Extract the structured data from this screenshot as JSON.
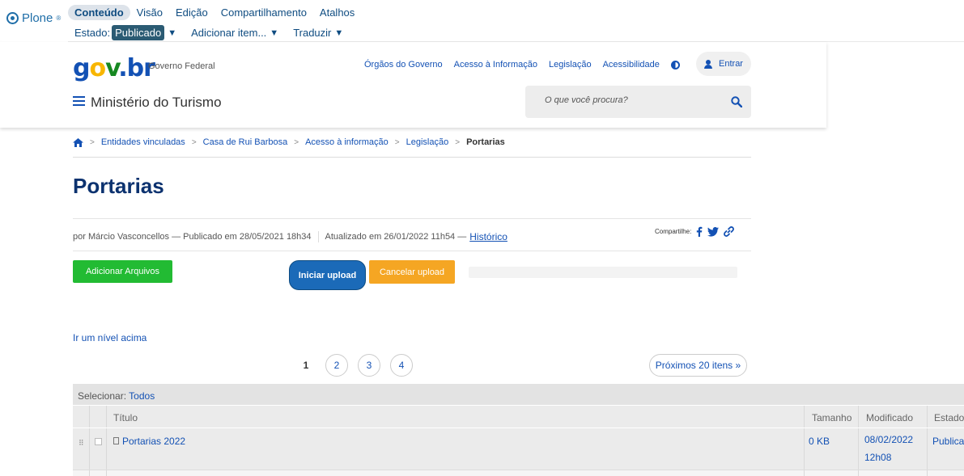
{
  "plone": {
    "logo": "Plone"
  },
  "toolbar": {
    "tabs": [
      {
        "label": "Conteúdo",
        "active": true
      },
      {
        "label": "Visão",
        "active": false
      },
      {
        "label": "Edição",
        "active": false
      },
      {
        "label": "Compartilhamento",
        "active": false
      },
      {
        "label": "Atalhos",
        "active": false
      }
    ],
    "state_label": "Estado:",
    "state_value": "Publicado",
    "add_item": "Adicionar item...",
    "translate": "Traduzir"
  },
  "header": {
    "logo": {
      "g": "g",
      "o": "o",
      "v": "v",
      "b": ".br"
    },
    "gov_fed": "Governo Federal",
    "links": [
      "Órgãos do Governo",
      "Acesso à Informação",
      "Legislação",
      "Acessibilidade"
    ],
    "login": "Entrar",
    "ministry": "Ministério do Turismo",
    "search_placeholder": "O que você procura?"
  },
  "breadcrumb": {
    "items": [
      "Entidades vinculadas",
      "Casa de Rui Barbosa",
      "Acesso à informação",
      "Legislação"
    ],
    "current": "Portarias"
  },
  "page": {
    "title": "Portarias",
    "byline": "por Márcio Vasconcellos — Publicado em 28/05/2021 18h34",
    "updated": "Atualizado em 26/01/2022 11h54 —",
    "history": "Histórico",
    "share_label": "Compartilhe:"
  },
  "upload": {
    "add_files": "Adicionar Arquivos",
    "start": "Iniciar upload",
    "cancel": "Cancelar upload",
    "progress": 0
  },
  "nav": {
    "up_level": "Ir um nível acima",
    "pages": [
      "1",
      "2",
      "3",
      "4"
    ],
    "current_page": "1",
    "next": "Próximos 20 itens »"
  },
  "table": {
    "select_label": "Selecionar:",
    "select_all": "Todos",
    "headers": {
      "title": "Título",
      "size": "Tamanho",
      "modified": "Modificado",
      "state": "Estado"
    },
    "rows": [
      {
        "title": "Portarias 2022",
        "size": "0 KB",
        "modified_date": "08/02/2022",
        "modified_time": "12h08",
        "state": "Publica"
      }
    ]
  },
  "colors": {
    "primary": "#1351b4",
    "title": "#0c326f",
    "add": "#22bb33",
    "start": "#1b6ab8",
    "cancel": "#f5a623"
  }
}
